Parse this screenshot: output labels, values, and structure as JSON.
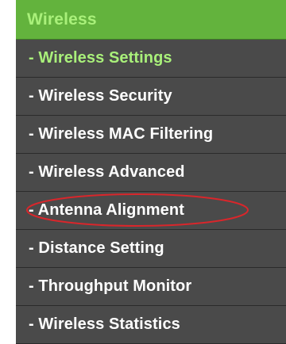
{
  "menu": {
    "header": "Wireless",
    "items": [
      {
        "label": "- Wireless Settings",
        "active": true
      },
      {
        "label": "- Wireless Security",
        "active": false
      },
      {
        "label": "- Wireless MAC Filtering",
        "active": false
      },
      {
        "label": "- Wireless Advanced",
        "active": false
      },
      {
        "label": "- Antenna Alignment",
        "active": false,
        "highlighted": true
      },
      {
        "label": "- Distance Setting",
        "active": false
      },
      {
        "label": "- Throughput Monitor",
        "active": false
      },
      {
        "label": "- Wireless Statistics",
        "active": false
      }
    ]
  },
  "colors": {
    "header_bg": "#63b33d",
    "header_text": "#a9f07a",
    "menu_bg": "#4a4a4a",
    "active_text": "#a9f07a",
    "item_text": "#ffffff",
    "highlight_ellipse": "#d9262b"
  }
}
